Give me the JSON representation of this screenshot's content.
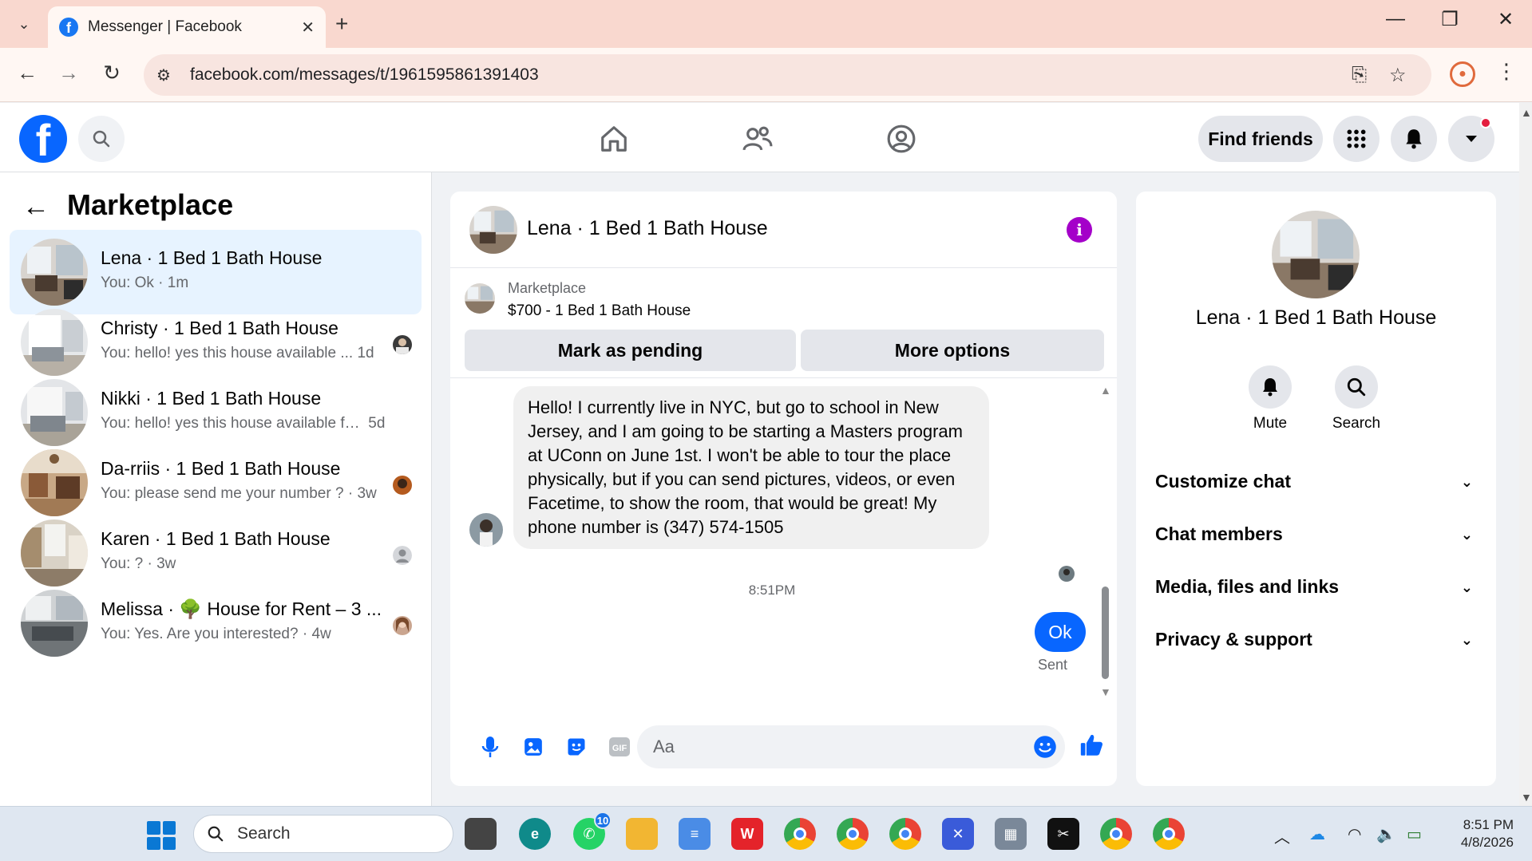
{
  "browser": {
    "tab_title": "Messenger | Facebook",
    "url": "facebook.com/messages/t/1961595861391403"
  },
  "header": {
    "find_friends": "Find friends"
  },
  "sidebar": {
    "title": "Marketplace",
    "conversations": [
      {
        "name": "Lena · 1 Bed 1 Bath House",
        "snippet": "You: Ok",
        "time": "1m",
        "active": true
      },
      {
        "name": "Christy · 1 Bed 1 Bath House",
        "snippet": "You: hello! yes this house available ...",
        "time": "1d"
      },
      {
        "name": "Nikki · 1 Bed 1 Bath House",
        "snippet": "You: hello! yes this house available for...",
        "time": "5d"
      },
      {
        "name": "Da-rriis · 1 Bed 1 Bath House",
        "snippet": "You: please send me your number ?",
        "time": "3w"
      },
      {
        "name": "Karen · 1 Bed 1 Bath House",
        "snippet": "You: ?",
        "time": "3w"
      },
      {
        "name": "Melissa · 🌳 House for Rent – 3 ...",
        "snippet": "You: Yes. Are you interested?",
        "time": "4w"
      }
    ]
  },
  "chat": {
    "title": "Lena · 1 Bed 1 Bath House",
    "marketplace_label": "Marketplace",
    "listing": "$700 - 1 Bed 1 Bath House",
    "mark_pending": "Mark as pending",
    "more_options": "More options",
    "incoming_message": "Hello! I currently live in NYC, but go to school in New Jersey, and I am going to be starting a Masters program at UConn on June 1st. I won't be able to tour the place physically, but if you can send pictures, videos, or even Facetime, to show the room, that would be great! My phone number is (347) 574-1505",
    "timestamp": "8:51PM",
    "outgoing_message": "Ok",
    "sent_status": "Sent",
    "composer_placeholder": "Aa"
  },
  "info_panel": {
    "name": "Lena · 1 Bed 1 Bath House",
    "mute": "Mute",
    "search": "Search",
    "sections": [
      "Customize chat",
      "Chat members",
      "Media, files and links",
      "Privacy & support"
    ]
  },
  "taskbar": {
    "search": "Search",
    "whatsapp_badge": "10",
    "time": "8:51 PM",
    "date": "4/8/2026"
  },
  "colors": {
    "fb_blue": "#0866ff",
    "info_purple": "#a400c9",
    "active_conversation": "#e7f3ff"
  }
}
